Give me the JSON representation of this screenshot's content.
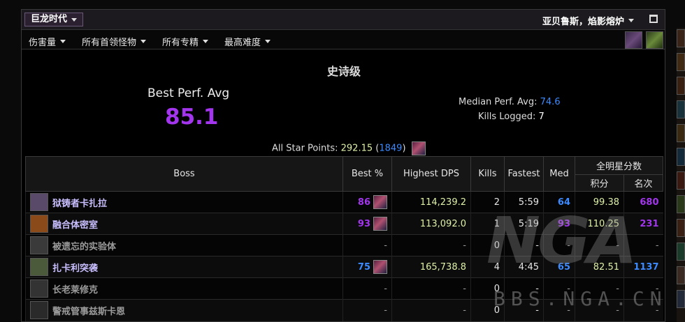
{
  "titlebar": {
    "zone": "巨龙时代",
    "character": "亚贝鲁斯，焰影熔炉"
  },
  "filters": [
    "伤害量",
    "所有首领怪物",
    "所有专精",
    "最高难度"
  ],
  "summary": {
    "difficulty": "史诗级",
    "best_perf_label": "Best Perf. Avg",
    "best_perf_value": "85.1",
    "median_label": "Median Perf. Avg:",
    "median_value": "74.6",
    "kills_label": "Kills Logged:",
    "kills_value": "7",
    "star_label": "All Star Points:",
    "star_points": "292.15",
    "star_rank": "1849"
  },
  "table": {
    "headers": {
      "boss": "Boss",
      "best": "Best %",
      "dps": "Highest DPS",
      "kills": "Kills",
      "fastest": "Fastest",
      "med": "Med",
      "allstar": "全明星分数",
      "points": "积分",
      "rank": "名次"
    },
    "rows": [
      {
        "name": "狱铸者卡扎拉",
        "best": "86",
        "dps": "114,239.2",
        "kills": "2",
        "fastest": "5:59",
        "med": "64",
        "points": "99.38",
        "rank": "680",
        "active": true
      },
      {
        "name": "融合体密室",
        "best": "93",
        "dps": "113,092.0",
        "kills": "1",
        "fastest": "5:19",
        "med": "93",
        "points": "110.25",
        "rank": "231",
        "active": true
      },
      {
        "name": "被遗忘的实验体",
        "best": "-",
        "dps": "-",
        "kills": "0",
        "fastest": "-",
        "med": "-",
        "points": "-",
        "rank": "-",
        "active": false
      },
      {
        "name": "扎卡利突袭",
        "best": "75",
        "dps": "165,738.8",
        "kills": "4",
        "fastest": "4:45",
        "med": "65",
        "points": "82.51",
        "rank": "1137",
        "active": true
      },
      {
        "name": "长老莱修克",
        "best": "-",
        "dps": "-",
        "kills": "0",
        "fastest": "-",
        "med": "-",
        "points": "-",
        "rank": "-",
        "active": false
      },
      {
        "name": "警戒管事兹斯卡恩",
        "best": "-",
        "dps": "-",
        "kills": "0",
        "fastest": "-",
        "med": "-",
        "points": "-",
        "rank": "-",
        "active": false
      }
    ]
  },
  "watermark": {
    "logo": "NGA",
    "url": "BBS.NGA.CN"
  },
  "colors": {
    "epic": "#a335ee",
    "rare": "#3d8bff",
    "dps": "#ddf0a8"
  }
}
